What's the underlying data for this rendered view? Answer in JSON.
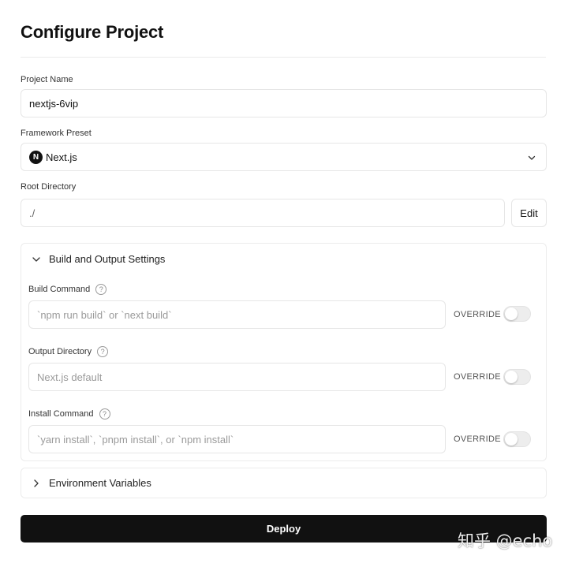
{
  "page": {
    "title": "Configure Project"
  },
  "project_name": {
    "label": "Project Name",
    "value": "nextjs-6vip"
  },
  "framework_preset": {
    "label": "Framework Preset",
    "selected": "Next.js",
    "logo_letter": "N",
    "icon": "chevron-down-icon"
  },
  "root_directory": {
    "label": "Root Directory",
    "value": "./",
    "edit_label": "Edit"
  },
  "build_settings": {
    "title": "Build and Output Settings",
    "expanded": true,
    "override_label": "OVERRIDE",
    "fields": [
      {
        "label": "Build Command",
        "placeholder": "`npm run build` or `next build`",
        "override": false
      },
      {
        "label": "Output Directory",
        "placeholder": "Next.js default",
        "override": false
      },
      {
        "label": "Install Command",
        "placeholder": "`yarn install`, `pnpm install`, or `npm install`",
        "override": false
      }
    ],
    "help_glyph": "?"
  },
  "environment_variables": {
    "title": "Environment Variables",
    "expanded": false
  },
  "deploy": {
    "label": "Deploy"
  },
  "watermark": {
    "text": "知乎 @echo"
  },
  "colors": {
    "primary_button": "#111111",
    "border": "#e6e6e6",
    "toggle_off": "#ededed"
  }
}
